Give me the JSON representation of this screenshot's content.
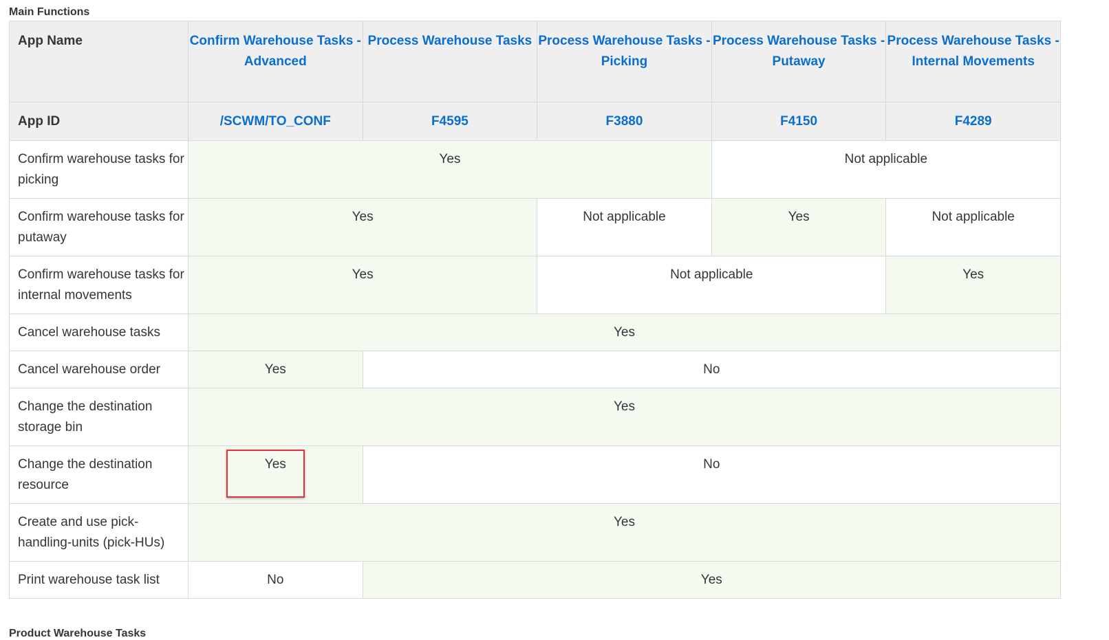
{
  "section_title": "Main Functions",
  "next_section_title": "Product Warehouse Tasks",
  "header": {
    "app_name_label": "App Name",
    "app_id_label": "App ID",
    "apps": [
      {
        "name": "Confirm Warehouse Tasks - Advanced",
        "id": "/SCWM/TO_CONF"
      },
      {
        "name": "Process Warehouse Tasks",
        "id": "F4595"
      },
      {
        "name": "Process Warehouse Tasks - Picking",
        "id": "F3880"
      },
      {
        "name": "Process Warehouse Tasks - Putaway",
        "id": "F4150"
      },
      {
        "name": "Process Warehouse Tasks - Internal Movements",
        "id": "F4289"
      }
    ]
  },
  "rows": [
    {
      "label": "Confirm warehouse tasks for picking",
      "cells": [
        {
          "text": "Yes",
          "span": 3
        },
        {
          "text": "Not applicable",
          "span": 2
        }
      ]
    },
    {
      "label": "Confirm warehouse tasks for putaway",
      "cells": [
        {
          "text": "Yes",
          "span": 2
        },
        {
          "text": "Not applicable",
          "span": 1
        },
        {
          "text": "Yes",
          "span": 1
        },
        {
          "text": "Not applicable",
          "span": 1
        }
      ]
    },
    {
      "label": "Confirm warehouse tasks for internal movements",
      "cells": [
        {
          "text": "Yes",
          "span": 2
        },
        {
          "text": "Not applicable",
          "span": 2
        },
        {
          "text": "Yes",
          "span": 1
        }
      ]
    },
    {
      "label": "Cancel warehouse tasks",
      "cells": [
        {
          "text": "Yes",
          "span": 5
        }
      ]
    },
    {
      "label": "Cancel warehouse order",
      "cells": [
        {
          "text": "Yes",
          "span": 1
        },
        {
          "text": "No",
          "span": 4
        }
      ]
    },
    {
      "label": "Change the destination storage bin",
      "cells": [
        {
          "text": "Yes",
          "span": 5
        }
      ]
    },
    {
      "label": "Change the destination resource",
      "cells": [
        {
          "text": "Yes",
          "span": 1,
          "highlighted": true
        },
        {
          "text": "No",
          "span": 4
        }
      ]
    },
    {
      "label": "Create and use pick-handling-units (pick-HUs)",
      "cells": [
        {
          "text": "Yes",
          "span": 5
        }
      ]
    },
    {
      "label": "Print warehouse task list",
      "cells": [
        {
          "text": "No",
          "span": 1
        },
        {
          "text": "Yes",
          "span": 4
        }
      ]
    }
  ],
  "colors": {
    "link": "#0a6ed1",
    "header_bg": "#efefef",
    "yes_bg": "#f5faf0",
    "highlight_border": "#d9363e"
  }
}
